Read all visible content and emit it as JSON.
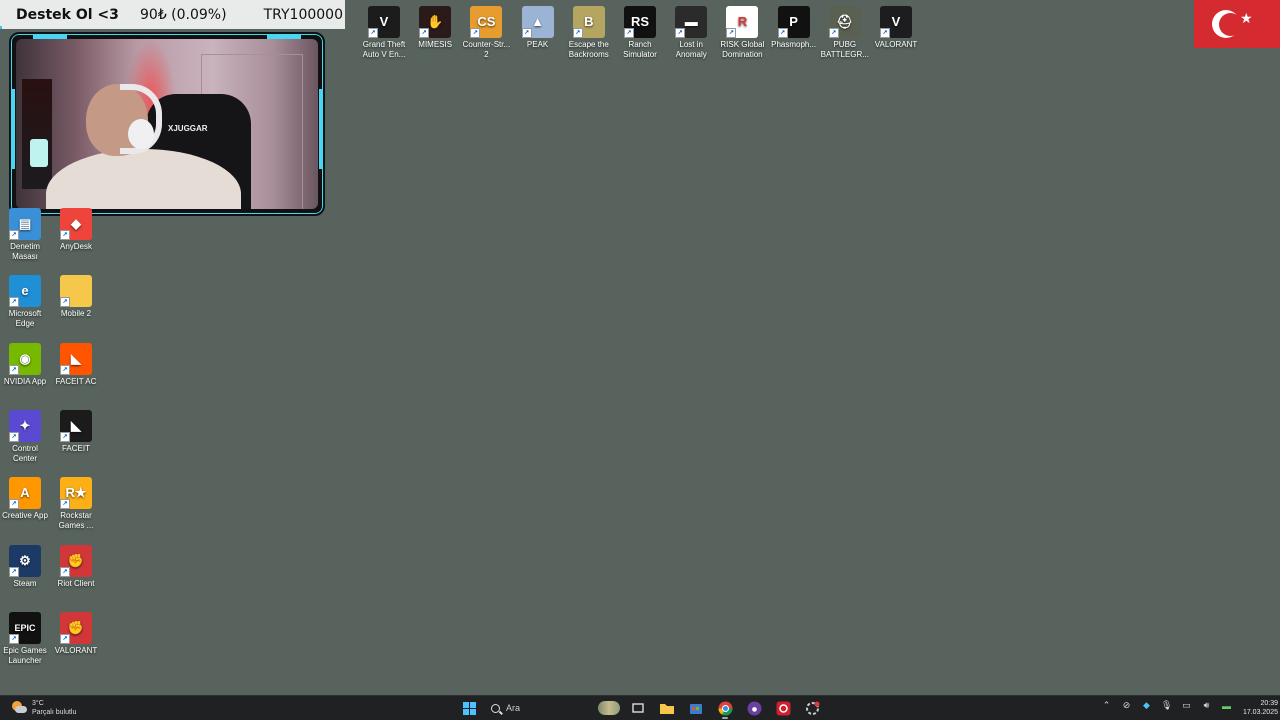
{
  "donation": {
    "label": "Destek Ol <3",
    "amount": "90₺ (0.09%)",
    "goal": "TRY100000",
    "progress_percent": 0.09
  },
  "top_icons": [
    {
      "label": "Grand Theft Auto V En...",
      "icon": "gta-v-icon",
      "glyph": "V",
      "color": "#1c1c1c"
    },
    {
      "label": "MIMESIS",
      "icon": "mimesis-icon",
      "glyph": "✋",
      "color": "#2a1a1a"
    },
    {
      "label": "Counter-Str... 2",
      "icon": "counter-strike-icon",
      "glyph": "CS",
      "color": "#e79c2f"
    },
    {
      "label": "PEAK",
      "icon": "peak-icon",
      "glyph": "▲",
      "color": "#9bb4d6"
    },
    {
      "label": "Escape the Backrooms",
      "icon": "escape-backrooms-icon",
      "glyph": "B",
      "color": "#b4a560"
    },
    {
      "label": "Ranch Simulator",
      "icon": "ranch-simulator-icon",
      "glyph": "RS",
      "color": "#111111"
    },
    {
      "label": "Lost in Anomaly",
      "icon": "lost-in-anomaly-icon",
      "glyph": "▬",
      "color": "#2b2b2b"
    },
    {
      "label": "RISK Global Domination",
      "icon": "risk-icon",
      "glyph": "R",
      "color": "#ffffff"
    },
    {
      "label": "Phasmoph...",
      "icon": "phasmophobia-icon",
      "glyph": "P",
      "color": "#111111"
    },
    {
      "label": "PUBG BATTLEGR...",
      "icon": "pubg-icon",
      "glyph": "⛑",
      "color": "#5b6152"
    },
    {
      "label": "VALORANT",
      "icon": "valorant-icon",
      "glyph": "V",
      "color": "#1d1d1f"
    }
  ],
  "left_icons": [
    {
      "label": "Denetim Masası",
      "icon": "control-panel-icon",
      "glyph": "▤",
      "color": "#3b8fd6"
    },
    {
      "label": "AnyDesk",
      "icon": "anydesk-icon",
      "glyph": "◆",
      "color": "#ef443b"
    },
    {
      "label": "Microsoft Edge",
      "icon": "edge-icon",
      "glyph": "e",
      "color": "#1f8fd6"
    },
    {
      "label": "Mobile 2",
      "icon": "folder-icon",
      "glyph": "",
      "color": "#f5c84c"
    },
    {
      "label": "NVIDIA App",
      "icon": "nvidia-icon",
      "glyph": "◉",
      "color": "#76b900"
    },
    {
      "label": "FACEIT AC",
      "icon": "faceit-ac-icon",
      "glyph": "◣",
      "color": "#ff5500"
    },
    {
      "label": "Control Center",
      "icon": "control-center-icon",
      "glyph": "✦",
      "color": "#5a4ad1"
    },
    {
      "label": "FACEIT",
      "icon": "faceit-icon",
      "glyph": "◣",
      "color": "#1b1b1b"
    },
    {
      "label": "Creative App",
      "icon": "creative-app-icon",
      "glyph": "A",
      "color": "#ff9800"
    },
    {
      "label": "Rockstar Games ...",
      "icon": "rockstar-icon",
      "glyph": "R★",
      "color": "#fcaf17"
    },
    {
      "label": "Steam",
      "icon": "steam-icon",
      "glyph": "⚙",
      "color": "#1b3a66"
    },
    {
      "label": "Riot Client",
      "icon": "riot-client-icon",
      "glyph": "✊",
      "color": "#d13639"
    },
    {
      "label": "Epic Games Launcher",
      "icon": "epic-games-icon",
      "glyph": "EPIC",
      "color": "#111111"
    },
    {
      "label": "VALORANT",
      "icon": "valorant-riot-icon",
      "glyph": "✊",
      "color": "#d13639"
    }
  ],
  "taskbar": {
    "weather_temp": "3°C",
    "weather_text": "Parçalı bulutlu",
    "search_placeholder": "Ara",
    "clock_time": "20:39",
    "clock_date": "17.03.2025"
  },
  "colors": {
    "desktop": "#57635c",
    "accent": "#49d6f0",
    "taskbar": "#1f2123",
    "flag_red": "#d52a30"
  }
}
